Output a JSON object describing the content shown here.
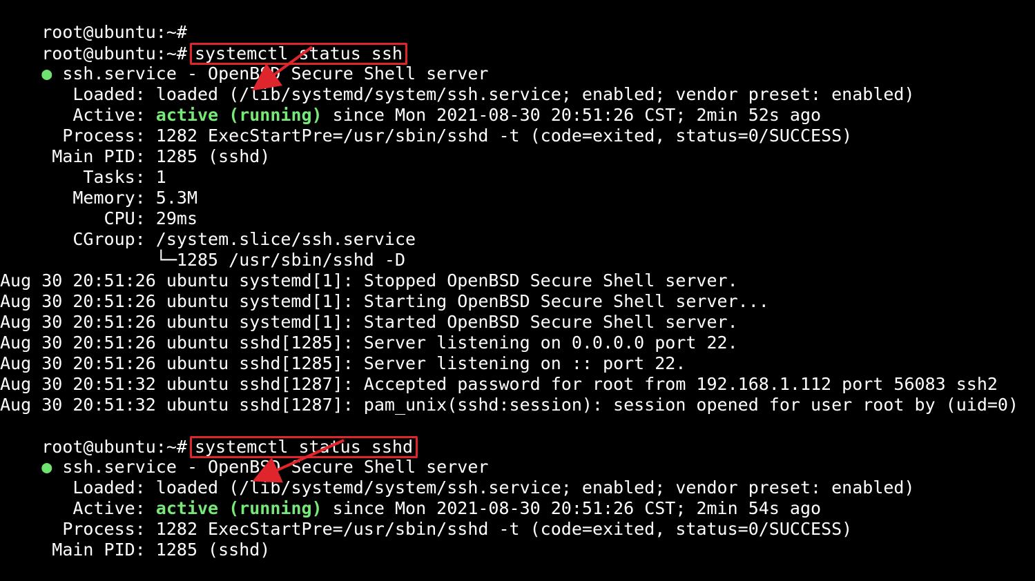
{
  "prompt": "root@ubuntu:~#",
  "block1": {
    "command": "systemctl status ssh",
    "dot": "●",
    "service_line": " ssh.service - OpenBSD Secure Shell server",
    "loaded_label": "   Loaded:",
    "loaded_value": " loaded (/lib/systemd/system/ssh.service; enabled; vendor preset: enabled)",
    "active_label": "   Active:",
    "active_state": " active (running)",
    "active_since": " since Mon 2021-08-30 20:51:26 CST; 2min 52s ago",
    "process_label": "  Process:",
    "process_value": " 1282 ExecStartPre=/usr/sbin/sshd -t (code=exited, status=0/SUCCESS)",
    "mainpid_label": " Main PID:",
    "mainpid_value": " 1285 (sshd)",
    "tasks_label": "    Tasks:",
    "tasks_value": " 1",
    "memory_label": "   Memory:",
    "memory_value": " 5.3M",
    "cpu_label": "      CPU:",
    "cpu_value": " 29ms",
    "cgroup_label": "   CGroup:",
    "cgroup_value": " /system.slice/ssh.service",
    "cgroup_child": "           └─1285 /usr/sbin/sshd -D",
    "logs": [
      "Aug 30 20:51:26 ubuntu systemd[1]: Stopped OpenBSD Secure Shell server.",
      "Aug 30 20:51:26 ubuntu systemd[1]: Starting OpenBSD Secure Shell server...",
      "Aug 30 20:51:26 ubuntu systemd[1]: Started OpenBSD Secure Shell server.",
      "Aug 30 20:51:26 ubuntu sshd[1285]: Server listening on 0.0.0.0 port 22.",
      "Aug 30 20:51:26 ubuntu sshd[1285]: Server listening on :: port 22.",
      "Aug 30 20:51:32 ubuntu sshd[1287]: Accepted password for root from 192.168.1.112 port 56083 ssh2",
      "Aug 30 20:51:32 ubuntu sshd[1287]: pam_unix(sshd:session): session opened for user root by (uid=0)"
    ]
  },
  "block2": {
    "command": "systemctl status sshd",
    "dot": "●",
    "service_line": " ssh.service - OpenBSD Secure Shell server",
    "loaded_label": "   Loaded:",
    "loaded_value": " loaded (/lib/systemd/system/ssh.service; enabled; vendor preset: enabled)",
    "active_label": "   Active:",
    "active_state": " active (running)",
    "active_since": " since Mon 2021-08-30 20:51:26 CST; 2min 54s ago",
    "process_label": "  Process:",
    "process_value": " 1282 ExecStartPre=/usr/sbin/sshd -t (code=exited, status=0/SUCCESS)",
    "mainpid_label": " Main PID:",
    "mainpid_value": " 1285 (sshd)"
  },
  "colors": {
    "background": "#000000",
    "text": "#ffffff",
    "active_green": "#78e878",
    "highlight_red": "#e0262d"
  }
}
